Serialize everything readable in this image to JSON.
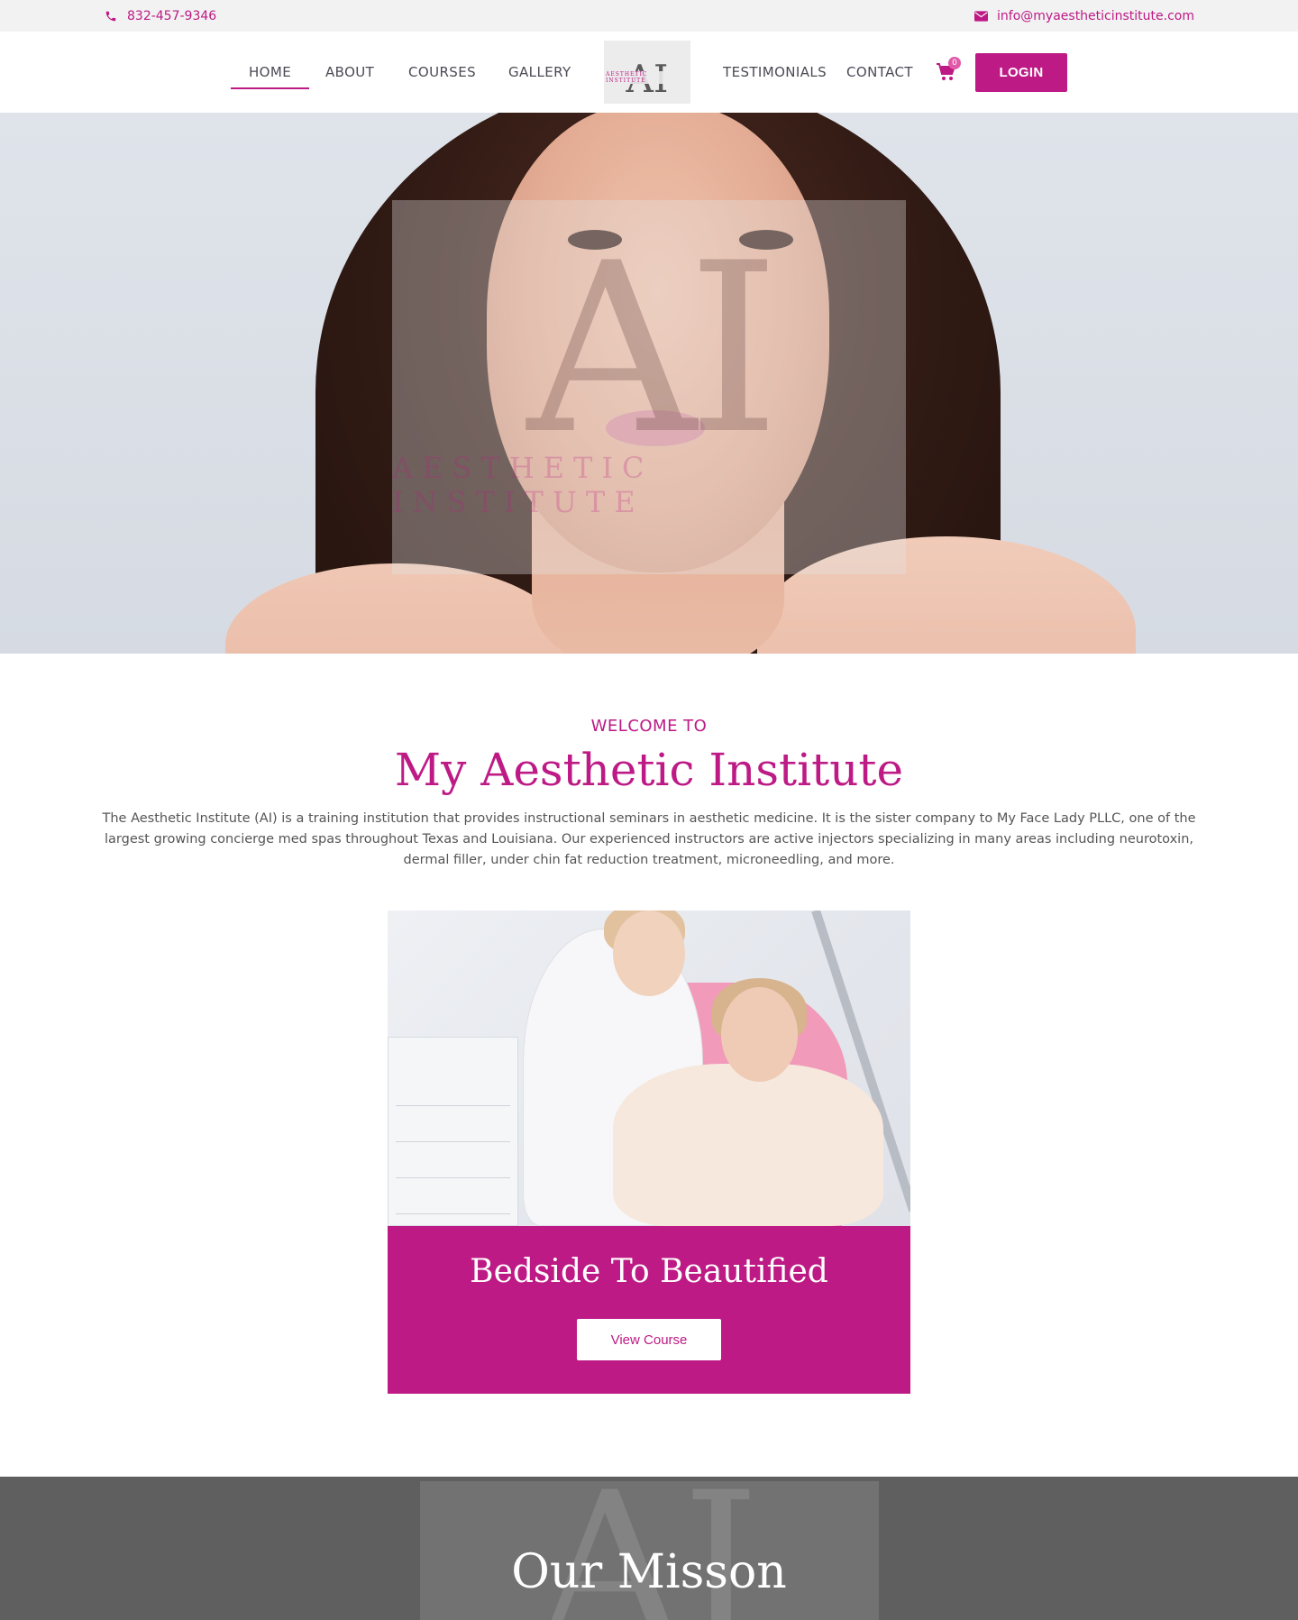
{
  "topbar": {
    "phone": "832-457-9346",
    "email": "info@myaestheticinstitute.com"
  },
  "nav": {
    "items": [
      "HOME",
      "ABOUT",
      "COURSES",
      "GALLERY",
      "TESTIMONIALS",
      "CONTACT"
    ],
    "active": "HOME",
    "cart_count": "0",
    "login_label": "LOGIN"
  },
  "logo": {
    "mark": "AI",
    "text": "AESTHETIC INSTITUTE"
  },
  "hero": {
    "watermark_mark": "AI",
    "watermark_text": "AESTHETIC INSTITUTE"
  },
  "welcome": {
    "kicker": "WELCOME TO",
    "title": "My Aesthetic Institute",
    "text": "The Aesthetic Institute (AI) is a training institution that provides instructional seminars in aesthetic medicine. It is the sister company to My Face Lady PLLC, one of the largest growing concierge med spas throughout Texas and Louisiana. Our experienced instructors are active injectors specializing in many areas including neurotoxin, dermal filler, under chin fat reduction treatment, microneedling, and more."
  },
  "course": {
    "title": "Bedside To Beautified",
    "button": "View Course"
  },
  "mission": {
    "title": "Our Misson"
  },
  "colors": {
    "accent": "#bd1a85",
    "topbar_bg": "#f2f2f2",
    "mission_bg": "#5f5f5f"
  }
}
